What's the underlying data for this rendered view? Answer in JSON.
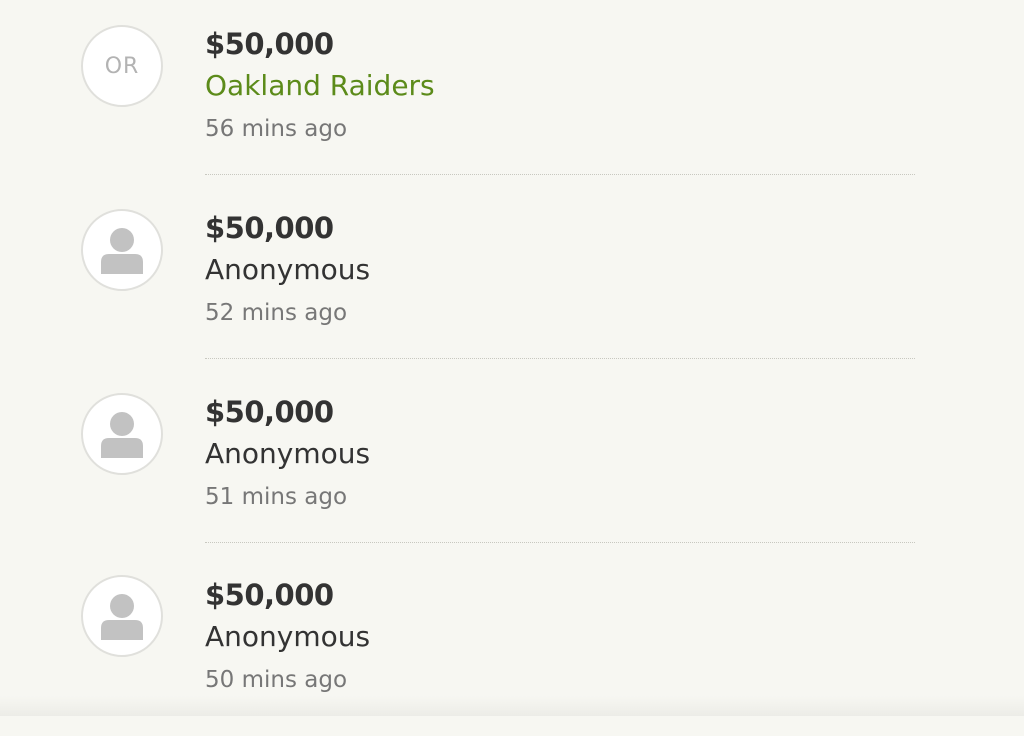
{
  "donations": [
    {
      "amount": "$50,000",
      "donor": "Oakland Raiders",
      "time": "56 mins ago",
      "avatar": {
        "type": "initials",
        "text": "OR"
      },
      "donor_color": "#5c8b1a"
    },
    {
      "amount": "$50,000",
      "donor": "Anonymous",
      "time": "52 mins ago",
      "avatar": {
        "type": "person-icon"
      }
    },
    {
      "amount": "$50,000",
      "donor": "Anonymous",
      "time": "51 mins ago",
      "avatar": {
        "type": "person-icon"
      }
    },
    {
      "amount": "$50,000",
      "donor": "Anonymous",
      "time": "50 mins ago",
      "avatar": {
        "type": "person-icon"
      }
    }
  ]
}
